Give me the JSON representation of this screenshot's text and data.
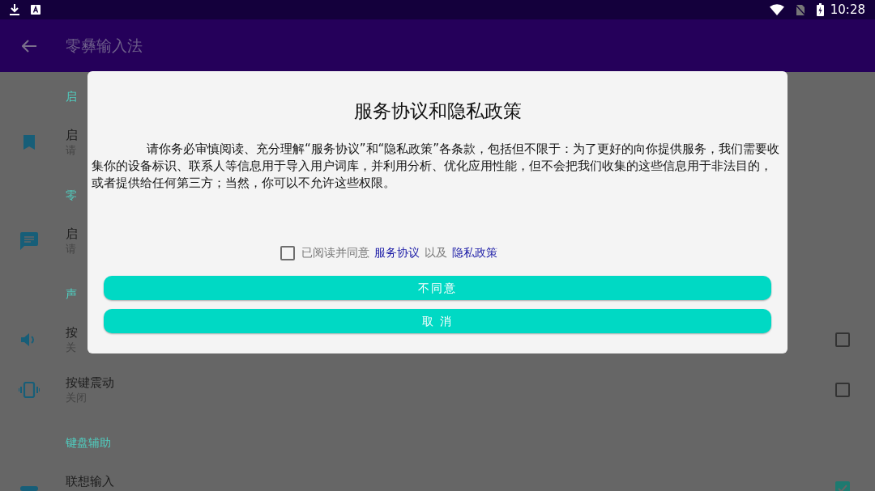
{
  "status_bar": {
    "time": "10:28"
  },
  "app_bar": {
    "title": "零彝输入法"
  },
  "sections": [
    {
      "header": "启",
      "items": [
        {
          "kind": "text",
          "title": "启",
          "subtitle": "请"
        }
      ]
    },
    {
      "header": "零",
      "items": [
        {
          "kind": "text",
          "title": "启",
          "subtitle": "请"
        }
      ]
    },
    {
      "header": "声",
      "items": [
        {
          "kind": "checkbox",
          "title": "按",
          "subtitle": "关",
          "checked": false
        },
        {
          "kind": "checkbox",
          "title": "按键震动",
          "subtitle": "关闭",
          "checked": false
        }
      ]
    },
    {
      "header": "键盘辅助",
      "items": [
        {
          "kind": "checkbox",
          "title": "联想输入",
          "checked": true
        }
      ]
    }
  ],
  "dialog": {
    "title": "服务协议和隐私政策",
    "body": "请你务必审慎阅读、充分理解“服务协议”和“隐私政策”各条款，包括但不限于：为了更好的向你提供服务，我们需要收集你的设备标识、联系人等信息用于导入用户词库，并利用分析、优化应用性能，但不会把我们收集的这些信息用于非法目的，或者提供给任何第三方；当然，你可以不允许这些权限。",
    "agree": {
      "checked": false,
      "label": "已阅读并同意",
      "link_1": "服务协议",
      "joiner": "以及",
      "link_2": "隐私政策"
    },
    "buttons": [
      "不同意",
      "取 消"
    ]
  }
}
